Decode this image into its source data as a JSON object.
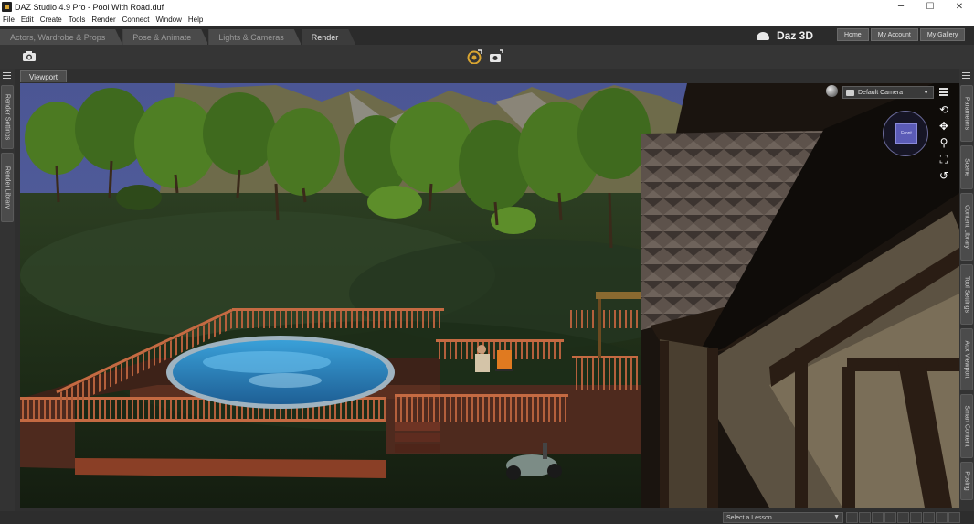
{
  "window": {
    "title": "DAZ Studio 4.9 Pro - Pool With Road.duf",
    "minimize": "─",
    "maximize": "☐",
    "close": "✕"
  },
  "menu": [
    "File",
    "Edit",
    "Create",
    "Tools",
    "Render",
    "Connect",
    "Window",
    "Help"
  ],
  "rooms": [
    {
      "label": "Actors, Wardrobe & Props"
    },
    {
      "label": "Pose & Animate"
    },
    {
      "label": "Lights & Cameras"
    },
    {
      "label": "Render"
    }
  ],
  "active_room": "Render",
  "brand": {
    "text": "Daz 3D"
  },
  "nav_buttons": [
    "Home",
    "My Account",
    "My Gallery"
  ],
  "left_panes": [
    "Render Settings",
    "Render Library"
  ],
  "right_panes": [
    "Parameters",
    "Scene",
    "Content Library",
    "Tool Settings",
    "Aux Viewport",
    "Smart Content",
    "Posing"
  ],
  "viewport": {
    "tab_label": "Viewport",
    "camera": "Default Camera",
    "cube_label": "Front"
  },
  "icons": {
    "toolbar": [
      "camera-icon",
      "render-icon",
      "render-camera-icon"
    ],
    "nav_tools": [
      "orbit-icon",
      "pan-icon",
      "zoom-icon",
      "frame-icon",
      "reset-icon"
    ]
  },
  "lesson": {
    "placeholder": "Select a Lesson..."
  },
  "colors": {
    "app_bg": "#3a3a3a",
    "sky": "#4a5490",
    "accent": "#d9a531"
  }
}
